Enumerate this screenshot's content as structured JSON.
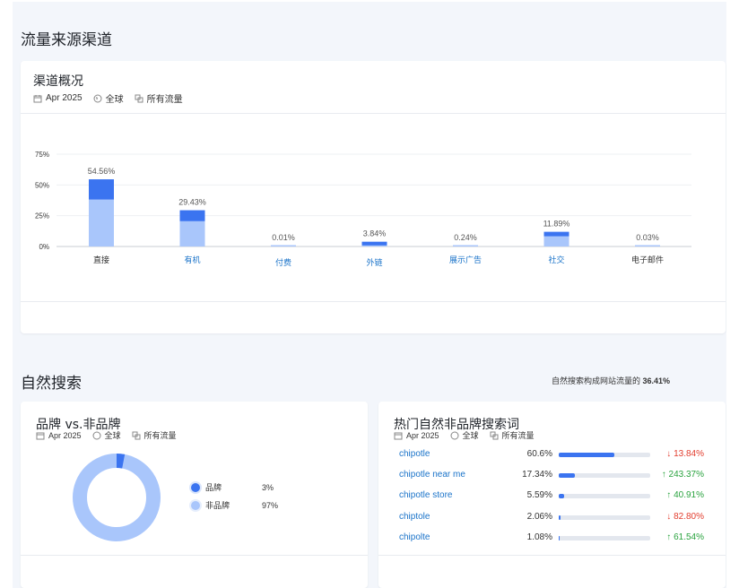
{
  "traffic_section": {
    "title": "流量来源渠道",
    "card_title": "渠道概况",
    "meta": {
      "date": "Apr 2025",
      "region": "全球",
      "traffic": "所有流量"
    },
    "y_ticks": [
      "75%",
      "50%",
      "25%",
      "0%"
    ],
    "chart_data": {
      "type": "bar",
      "categories": [
        "直接",
        "有机",
        "付费",
        "外链",
        "展示广告",
        "社交",
        "电子邮件"
      ],
      "values": [
        54.56,
        29.43,
        0.01,
        3.84,
        0.24,
        11.89,
        0.03
      ],
      "value_labels": [
        "54.56%",
        "29.43%",
        "0.01%",
        "3.84%",
        "0.24%",
        "11.89%",
        "0.03%"
      ],
      "ylim": [
        0,
        75
      ],
      "link_categories": [
        false,
        true,
        true,
        true,
        true,
        true,
        false
      ],
      "colors": {
        "dark": "#3b74f0",
        "light": "#a9c6fb"
      }
    }
  },
  "organic_section": {
    "title": "自然搜索",
    "share_text": "自然搜索构成网站流量的",
    "share_value": "36.41%",
    "brand_card": {
      "title": "品牌 vs.非品牌",
      "meta": {
        "date": "Apr 2025",
        "region": "全球",
        "traffic": "所有流量"
      },
      "legend": [
        {
          "label": "品牌",
          "value": "3%",
          "color": "#3b74f0"
        },
        {
          "label": "非品牌",
          "value": "97%",
          "color": "#a9c6fb"
        }
      ]
    },
    "keywords_card": {
      "title": "热门自然非品牌搜索词",
      "meta": {
        "date": "Apr 2025",
        "region": "全球",
        "traffic": "所有流量"
      },
      "rows": [
        {
          "keyword": "chipotle",
          "share": "60.6%",
          "share_value": 60.6,
          "change": "13.84%",
          "direction": "down"
        },
        {
          "keyword": "chipotle near me",
          "share": "17.34%",
          "share_value": 17.34,
          "change": "243.37%",
          "direction": "up"
        },
        {
          "keyword": "chipotle store",
          "share": "5.59%",
          "share_value": 5.59,
          "change": "40.91%",
          "direction": "up"
        },
        {
          "keyword": "chiptole",
          "share": "2.06%",
          "share_value": 2.06,
          "change": "82.80%",
          "direction": "down"
        },
        {
          "keyword": "chipolte",
          "share": "1.08%",
          "share_value": 1.08,
          "change": "61.54%",
          "direction": "up"
        }
      ]
    }
  }
}
